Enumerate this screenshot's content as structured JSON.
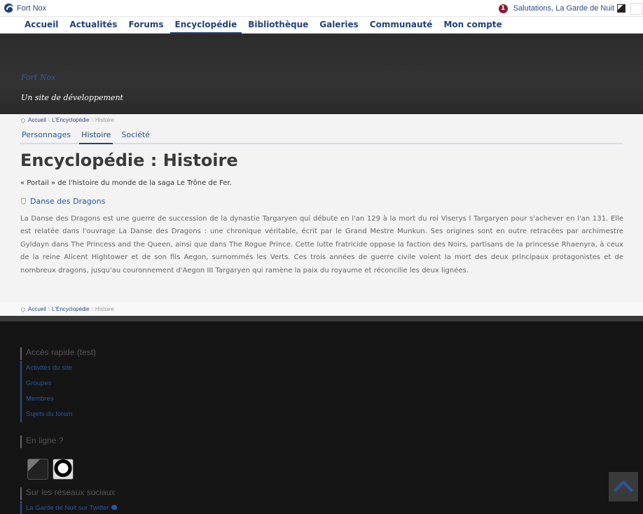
{
  "adminbar": {
    "site_name": "Fort Nox",
    "notification_count": "1",
    "greeting": "Salutations, La Garde de Nuit"
  },
  "nav": {
    "items": [
      "Accueil",
      "Actualités",
      "Forums",
      "Encyclopédie",
      "Bibliothèque",
      "Galeries",
      "Communauté",
      "Mon compte"
    ],
    "active": "Encyclopédie"
  },
  "header": {
    "title": "Fort Nox",
    "description": "Un site de développement"
  },
  "breadcrumb": {
    "home": "Accueil",
    "section": "L'Encyclopédie",
    "current": "Histoire",
    "separator": "\\"
  },
  "subnav": {
    "tabs": [
      "Personnages",
      "Histoire",
      "Société"
    ],
    "active": "Histoire"
  },
  "page": {
    "title": "Encyclopédie : Histoire",
    "intro": "« Portail » de l'histoire du monde de la saga Le Trône de Fer.",
    "section_title": "Danse des Dragons",
    "paragraph": "La Danse des Dragons est une guerre de succession de la dynastie Targaryen qui débute en l'an 129 à la mort du roi Viserys I Targaryen pour s'achever en l'an 131. Elle est relatée dans l'ouvrage La Danse des Dragons : une chronique véritable, écrit par le Grand Mestre Munkun. Ses origines sont en outre retracées par archimestre Gyldayn dans The Princess and the Queen, ainsi que dans The Rogue Prince. Cette lutte fratricide oppose la faction des Noirs, partisans de la princesse Rhaenyra, à ceux de la reine Alicent Hightower et de son fils Aegon, surnommés les Verts. Ces trois années de guerre civile voient la mort des deux principaux protagonistes et de nombreux dragons, jusqu'au couronnement d'Aegon III Targaryen qui ramène la paix du royaume et réconcilie les deux lignées."
  },
  "footer": {
    "quick_title": "Accès rapide (test)",
    "quick_links": [
      "Activités du site",
      "Groupes",
      "Membres",
      "Sujets du forum"
    ],
    "online_title": "En ligne ?",
    "social_title": "Sur les réseaux sociaux",
    "social_link": "La Garde de Nuit sur Twitter"
  },
  "colors": {
    "accent": "#23427a",
    "link": "#2a56a0",
    "notification": "#8b1a3a"
  }
}
